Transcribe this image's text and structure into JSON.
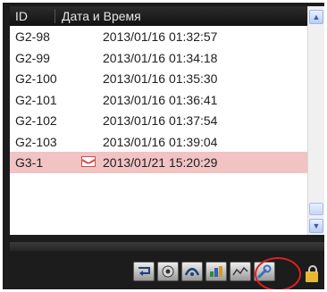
{
  "table": {
    "columns": [
      "ID",
      "Дата и Время"
    ],
    "rows": [
      {
        "id": "G2-98",
        "datetime": "2013/01/16  01:32:57"
      },
      {
        "id": "G2-99",
        "datetime": "2013/01/16  01:34:18"
      },
      {
        "id": "G2-100",
        "datetime": "2013/01/16  01:35:30"
      },
      {
        "id": "G2-101",
        "datetime": "2013/01/16  01:36:41"
      },
      {
        "id": "G2-102",
        "datetime": "2013/01/16  01:37:54"
      },
      {
        "id": "G2-103",
        "datetime": "2013/01/16  01:39:04"
      },
      {
        "id": "G3-1",
        "datetime": "2013/01/21  15:20:29",
        "icon": "mail-icon",
        "selected": true
      }
    ]
  },
  "scrollbar": {
    "up": "▲",
    "down": "▼"
  },
  "toolbar": {
    "buttons": [
      "replay-icon",
      "rec-icon",
      "connect-icon",
      "chart-icon",
      "graph-icon",
      "wrench-icon",
      "lock-icon"
    ],
    "highlighted": "wrench-icon"
  },
  "colors": {
    "selected_row": "#f1c3c3",
    "highlight_ring": "#e02020",
    "header_bg": "#1c1c1c"
  }
}
